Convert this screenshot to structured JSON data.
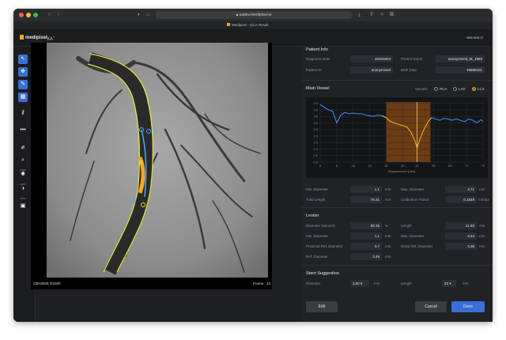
{
  "browser": {
    "url": "xadev.medipixel.io",
    "tab_title": "Medipixel - QCA Result"
  },
  "app": {
    "logo": "medipixel",
    "product": "XA",
    "product_sup": "+",
    "user": "test test"
  },
  "toolbar": {
    "zoom_label": "200%",
    "contrast_label": "100%",
    "brightness_label": "100%"
  },
  "viewer": {
    "image_id": "CBN3946 /02000",
    "frame": "Frame : 23"
  },
  "patient": {
    "title": "Patient Info",
    "diagnosis_date_label": "Diagnosis Date",
    "diagnosis_date": "20101004",
    "patient_name_label": "Patient Name",
    "patient_name": "anonymized_M_1969",
    "patient_id_label": "Patient ID",
    "patient_id": "anonymized",
    "birth_date_label": "Birth Date",
    "birth_date": "19690101"
  },
  "main_vessel": {
    "title": "Main Vessel",
    "vessels_label": "Vessels",
    "options": [
      "RCA",
      "LAD",
      "LCX"
    ],
    "selected": "LCX",
    "min_diameter_label": "Min. Diameter",
    "min_diameter": "1.1",
    "min_diameter_unit": "mm",
    "max_diameter_label": "Max. Diameter",
    "max_diameter": "4.71",
    "max_diameter_unit": "mm",
    "total_length_label": "Total Length",
    "total_length": "79.31",
    "total_length_unit": "mm",
    "calibration_label": "Calibration Factor",
    "calibration": "0.1549",
    "calibration_unit": "mm/px"
  },
  "lesion": {
    "title": "Lesion",
    "diameter_stenosis_label": "Diameter Stenosis",
    "diameter_stenosis": "68.15",
    "diameter_stenosis_unit": "%",
    "length_label": "Length",
    "length": "21.53",
    "length_unit": "mm",
    "min_diameter_label": "Min. Diameter",
    "min_diameter": "1.1",
    "min_diameter_unit": "mm",
    "max_diameter_label": "Max. Diameter",
    "max_diameter": "3.44",
    "max_diameter_unit": "mm",
    "prox_ref_label": "Proximal Ref. Diameter",
    "prox_ref": "3.7",
    "prox_ref_unit": "mm",
    "dist_ref_label": "Distal Ref. Diameter",
    "dist_ref": "3.38",
    "dist_ref_unit": "mm",
    "ref_diameter_label": "Ref. Diameter",
    "ref_diameter": "3.45",
    "ref_diameter_unit": "mm"
  },
  "stent": {
    "title": "Stent Suggestion",
    "diameter_label": "Diameter",
    "diameter": "3.50",
    "diameter_unit": "mm",
    "length_label": "Length",
    "length": "22",
    "length_unit": "mm"
  },
  "buttons": {
    "edit": "Edit",
    "cancel": "Cancel",
    "done": "Done"
  },
  "colors": {
    "accent": "#3b6fd8",
    "profile_line": "#3a8ef0",
    "lesion_line": "#f5a623",
    "lesion_band": "#8a4a14"
  },
  "chart_data": {
    "type": "line",
    "xlabel": "Displacement (mm)",
    "x_ticks": [
      0,
      8,
      16,
      24,
      32,
      40,
      47,
      55,
      63,
      71,
      79
    ],
    "y_ticks": [
      0,
      0.5,
      1.0,
      1.5,
      2.0,
      2.5,
      3.0,
      3.5,
      4.0,
      4.5
    ],
    "xlim": [
      0,
      79
    ],
    "ylim": [
      0,
      4.6
    ],
    "grid": true,
    "lesion_range": [
      32,
      53.5
    ],
    "min_marker_x": 47,
    "x": [
      0,
      2,
      4,
      6,
      8,
      10,
      12,
      14,
      16,
      18,
      20,
      22,
      24,
      26,
      28,
      30,
      32,
      34,
      36,
      38,
      40,
      42,
      44,
      46,
      47,
      48,
      50,
      52,
      54,
      56,
      58,
      60,
      62,
      64,
      66,
      68,
      70,
      72,
      74,
      76,
      78,
      79
    ],
    "values": [
      4.4,
      4.2,
      4.0,
      3.9,
      3.0,
      3.6,
      3.8,
      3.7,
      3.75,
      3.7,
      3.7,
      3.6,
      3.55,
      3.5,
      3.6,
      3.55,
      3.4,
      3.1,
      3.0,
      2.9,
      2.8,
      2.7,
      2.3,
      1.6,
      1.1,
      1.6,
      2.4,
      3.0,
      3.4,
      3.3,
      3.2,
      3.35,
      3.3,
      3.2,
      3.3,
      3.2,
      3.1,
      3.3,
      3.2,
      3.0,
      3.25,
      3.1
    ]
  }
}
